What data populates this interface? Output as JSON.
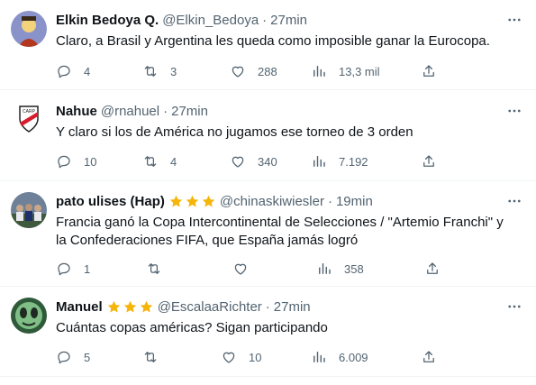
{
  "tweets": [
    {
      "name": "Elkin Bedoya Q.",
      "handle": "@Elkin_Bedoya",
      "separator": "·",
      "time": "27min",
      "stars": 0,
      "text_lines": [
        "Claro, a Brasil y Argentina les queda como imposible ganar la Eurocopa."
      ],
      "replies": "4",
      "retweets": "3",
      "likes": "288",
      "views": "13,3 mil",
      "avatar": "blue-gray-cartoon-avatar"
    },
    {
      "name": "Nahue",
      "handle": "@rnahuel",
      "separator": "·",
      "time": "27min",
      "stars": 0,
      "text_lines": [
        "Y claro si los de América no jugamos ese torneo de 3 orden"
      ],
      "replies": "10",
      "retweets": "4",
      "likes": "340",
      "views": "7.192",
      "avatar": "river-plate-crest-avatar"
    },
    {
      "name": "pato ulises (Hap)",
      "handle": "@chinaskiwiesler",
      "separator": "·",
      "time": "19min",
      "stars": 3,
      "text_lines": [
        "Francia ganó la Copa Intercontinental de Selecciones / \"Artemio Franchi\" y",
        "la Confederaciones FIFA, que España jamás logró"
      ],
      "replies": "1",
      "retweets": "",
      "likes": "",
      "views": "358",
      "avatar": "football-team-photo-avatar"
    },
    {
      "name": "Manuel",
      "handle": "@EscalaaRichter",
      "separator": "·",
      "time": "27min",
      "stars": 3,
      "text_lines": [
        "Cuántas copas américas? Sigan participando"
      ],
      "replies": "5",
      "retweets": "",
      "likes": "10",
      "views": "6.009",
      "avatar": "green-cartoon-face-avatar"
    }
  ],
  "colors": {
    "text": "#0f1419",
    "secondary": "#536471",
    "divider": "#eff3f4",
    "star": "#f5b50a"
  },
  "icons": [
    "reply-icon",
    "retweet-icon",
    "like-icon",
    "views-icon",
    "share-icon",
    "more-icon",
    "star-icon"
  ]
}
